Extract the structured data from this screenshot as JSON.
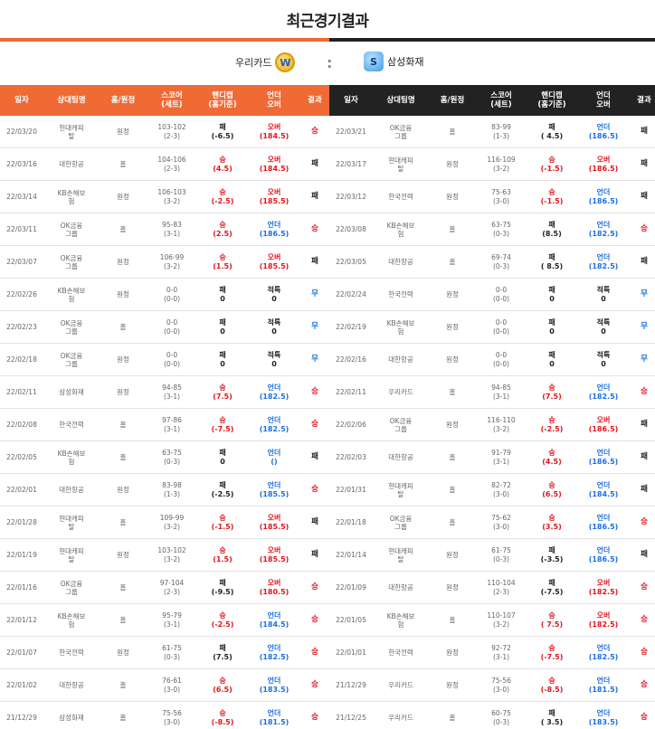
{
  "page": {
    "title": "최근경기결과"
  },
  "teams": {
    "left": "우리카드",
    "vs": ":",
    "right": "삼성화재",
    "left_logo_text": "W",
    "right_logo_text": "S"
  },
  "headers": [
    "일자",
    "상대팀명",
    "홈/원정",
    "스코어\n(세트)",
    "핸디캡\n(홈기준)",
    "언더\n오버",
    "결과"
  ],
  "left_rows": [
    {
      "date": "22/03/20",
      "opp": "현대캐피\n탈",
      "ha": "원정",
      "score": "103-102",
      "sets": "(2-3)",
      "hc_r": "패",
      "hc_v": "(-6.5)",
      "hc_c": "black",
      "ou_r": "오버",
      "ou_v": "(184.5)",
      "ou_c": "red",
      "res": "승",
      "res_c": "red"
    },
    {
      "date": "22/03/16",
      "opp": "대한항공",
      "ha": "홈",
      "score": "104-106",
      "sets": "(2-3)",
      "hc_r": "승",
      "hc_v": "(4.5)",
      "hc_c": "red",
      "ou_r": "오버",
      "ou_v": "(184.5)",
      "ou_c": "red",
      "res": "패",
      "res_c": "black"
    },
    {
      "date": "22/03/14",
      "opp": "KB손해보\n험",
      "ha": "원정",
      "score": "106-103",
      "sets": "(3-2)",
      "hc_r": "승",
      "hc_v": "(-2.5)",
      "hc_c": "red",
      "ou_r": "오버",
      "ou_v": "(185.5)",
      "ou_c": "red",
      "res": "패",
      "res_c": "black"
    },
    {
      "date": "22/03/11",
      "opp": "OK금융\n그룹",
      "ha": "홈",
      "score": "95-83",
      "sets": "(3-1)",
      "hc_r": "승",
      "hc_v": "(2.5)",
      "hc_c": "red",
      "ou_r": "언더",
      "ou_v": "(186.5)",
      "ou_c": "blue",
      "res": "승",
      "res_c": "red"
    },
    {
      "date": "22/03/07",
      "opp": "OK금융\n그룹",
      "ha": "원정",
      "score": "106-99",
      "sets": "(3-2)",
      "hc_r": "승",
      "hc_v": "(1.5)",
      "hc_c": "red",
      "ou_r": "오버",
      "ou_v": "(185.5)",
      "ou_c": "red",
      "res": "패",
      "res_c": "black"
    },
    {
      "date": "22/02/26",
      "opp": "KB손해보\n험",
      "ha": "원정",
      "score": "0-0",
      "sets": "(0-0)",
      "hc_r": "패",
      "hc_v": "0",
      "hc_c": "black",
      "ou_r": "적특",
      "ou_v": "0",
      "ou_c": "black",
      "res": "무",
      "res_c": "blue"
    },
    {
      "date": "22/02/23",
      "opp": "OK금융\n그룹",
      "ha": "홈",
      "score": "0-0",
      "sets": "(0-0)",
      "hc_r": "패",
      "hc_v": "0",
      "hc_c": "black",
      "ou_r": "적특",
      "ou_v": "0",
      "ou_c": "black",
      "res": "무",
      "res_c": "blue"
    },
    {
      "date": "22/02/18",
      "opp": "OK금융\n그룹",
      "ha": "원정",
      "score": "0-0",
      "sets": "(0-0)",
      "hc_r": "패",
      "hc_v": "0",
      "hc_c": "black",
      "ou_r": "적특",
      "ou_v": "0",
      "ou_c": "black",
      "res": "무",
      "res_c": "blue"
    },
    {
      "date": "22/02/11",
      "opp": "삼성화재",
      "ha": "원정",
      "score": "94-85",
      "sets": "(3-1)",
      "hc_r": "승",
      "hc_v": "(7.5)",
      "hc_c": "red",
      "ou_r": "언더",
      "ou_v": "(182.5)",
      "ou_c": "blue",
      "res": "승",
      "res_c": "red"
    },
    {
      "date": "22/02/08",
      "opp": "한국전력",
      "ha": "홈",
      "score": "97-86",
      "sets": "(3-1)",
      "hc_r": "승",
      "hc_v": "(-7.5)",
      "hc_c": "red",
      "ou_r": "언더",
      "ou_v": "(182.5)",
      "ou_c": "blue",
      "res": "승",
      "res_c": "red"
    },
    {
      "date": "22/02/05",
      "opp": "KB손해보\n험",
      "ha": "홈",
      "score": "63-75",
      "sets": "(0-3)",
      "hc_r": "패",
      "hc_v": "0",
      "hc_c": "black",
      "ou_r": "언더",
      "ou_v": "()",
      "ou_c": "blue",
      "res": "패",
      "res_c": "black"
    },
    {
      "date": "22/02/01",
      "opp": "대한항공",
      "ha": "원정",
      "score": "83-98",
      "sets": "(1-3)",
      "hc_r": "패",
      "hc_v": "(-2.5)",
      "hc_c": "black",
      "ou_r": "언더",
      "ou_v": "(185.5)",
      "ou_c": "blue",
      "res": "승",
      "res_c": "red"
    },
    {
      "date": "22/01/28",
      "opp": "현대캐피\n탈",
      "ha": "홈",
      "score": "109-99",
      "sets": "(3-2)",
      "hc_r": "승",
      "hc_v": "(-1.5)",
      "hc_c": "red",
      "ou_r": "오버",
      "ou_v": "(185.5)",
      "ou_c": "red",
      "res": "패",
      "res_c": "black"
    },
    {
      "date": "22/01/19",
      "opp": "현대캐피\n탈",
      "ha": "원정",
      "score": "103-102",
      "sets": "(3-2)",
      "hc_r": "승",
      "hc_v": "(1.5)",
      "hc_c": "red",
      "ou_r": "오버",
      "ou_v": "(185.5)",
      "ou_c": "red",
      "res": "패",
      "res_c": "black"
    },
    {
      "date": "22/01/16",
      "opp": "OK금융\n그룹",
      "ha": "홈",
      "score": "97-104",
      "sets": "(2-3)",
      "hc_r": "패",
      "hc_v": "(-9.5)",
      "hc_c": "black",
      "ou_r": "오버",
      "ou_v": "(180.5)",
      "ou_c": "red",
      "res": "승",
      "res_c": "red"
    },
    {
      "date": "22/01/12",
      "opp": "KB손해보\n험",
      "ha": "홈",
      "score": "95-79",
      "sets": "(3-1)",
      "hc_r": "승",
      "hc_v": "(-2.5)",
      "hc_c": "red",
      "ou_r": "언더",
      "ou_v": "(184.5)",
      "ou_c": "blue",
      "res": "승",
      "res_c": "red"
    },
    {
      "date": "22/01/07",
      "opp": "한국전력",
      "ha": "원정",
      "score": "61-75",
      "sets": "(0-3)",
      "hc_r": "패",
      "hc_v": "(7.5)",
      "hc_c": "black",
      "ou_r": "언더",
      "ou_v": "(182.5)",
      "ou_c": "blue",
      "res": "승",
      "res_c": "red"
    },
    {
      "date": "22/01/02",
      "opp": "대한항공",
      "ha": "홈",
      "score": "76-61",
      "sets": "(3-0)",
      "hc_r": "승",
      "hc_v": "(6.5)",
      "hc_c": "red",
      "ou_r": "언더",
      "ou_v": "(183.5)",
      "ou_c": "blue",
      "res": "승",
      "res_c": "red"
    },
    {
      "date": "21/12/29",
      "opp": "삼성화재",
      "ha": "홈",
      "score": "75-56",
      "sets": "(3-0)",
      "hc_r": "승",
      "hc_v": "(-8.5)",
      "hc_c": "red",
      "ou_r": "언더",
      "ou_v": "(181.5)",
      "ou_c": "blue",
      "res": "승",
      "res_c": "red"
    }
  ],
  "right_rows": [
    {
      "date": "22/03/21",
      "opp": "OK금융\n그룹",
      "ha": "홈",
      "score": "83-99",
      "sets": "(1-3)",
      "hc_r": "패",
      "hc_v": "( 4.5)",
      "hc_c": "black",
      "ou_r": "언더",
      "ou_v": "(186.5)",
      "ou_c": "blue",
      "res": "패",
      "res_c": "black"
    },
    {
      "date": "22/03/17",
      "opp": "현대캐피\n탈",
      "ha": "원정",
      "score": "116-109",
      "sets": "(3-2)",
      "hc_r": "승",
      "hc_v": "(-1.5)",
      "hc_c": "red",
      "ou_r": "오버",
      "ou_v": "(186.5)",
      "ou_c": "red",
      "res": "패",
      "res_c": "black"
    },
    {
      "date": "22/03/12",
      "opp": "한국전력",
      "ha": "원정",
      "score": "75-63",
      "sets": "(3-0)",
      "hc_r": "승",
      "hc_v": "(-1.5)",
      "hc_c": "red",
      "ou_r": "언더",
      "ou_v": "(186.5)",
      "ou_c": "blue",
      "res": "패",
      "res_c": "black"
    },
    {
      "date": "22/03/08",
      "opp": "KB손해보\n험",
      "ha": "홈",
      "score": "63-75",
      "sets": "(0-3)",
      "hc_r": "패",
      "hc_v": "(8.5)",
      "hc_c": "black",
      "ou_r": "언더",
      "ou_v": "(182.5)",
      "ou_c": "blue",
      "res": "승",
      "res_c": "red"
    },
    {
      "date": "22/03/05",
      "opp": "대한항공",
      "ha": "홈",
      "score": "69-74",
      "sets": "(0-3)",
      "hc_r": "패",
      "hc_v": "( 8.5)",
      "hc_c": "black",
      "ou_r": "언더",
      "ou_v": "(182.5)",
      "ou_c": "blue",
      "res": "패",
      "res_c": "black"
    },
    {
      "date": "22/02/24",
      "opp": "한국전력",
      "ha": "원정",
      "score": "0-0",
      "sets": "(0-0)",
      "hc_r": "패",
      "hc_v": "0",
      "hc_c": "black",
      "ou_r": "적특",
      "ou_v": "0",
      "ou_c": "black",
      "res": "무",
      "res_c": "blue"
    },
    {
      "date": "22/02/19",
      "opp": "KB손해보\n험",
      "ha": "원정",
      "score": "0-0",
      "sets": "(0-0)",
      "hc_r": "패",
      "hc_v": "0",
      "hc_c": "black",
      "ou_r": "적특",
      "ou_v": "0",
      "ou_c": "black",
      "res": "무",
      "res_c": "blue"
    },
    {
      "date": "22/02/16",
      "opp": "대한항공",
      "ha": "원정",
      "score": "0-0",
      "sets": "(0-0)",
      "hc_r": "패",
      "hc_v": "0",
      "hc_c": "black",
      "ou_r": "적특",
      "ou_v": "0",
      "ou_c": "black",
      "res": "무",
      "res_c": "blue"
    },
    {
      "date": "22/02/11",
      "opp": "우리카드",
      "ha": "홈",
      "score": "94-85",
      "sets": "(3-1)",
      "hc_r": "승",
      "hc_v": "(7.5)",
      "hc_c": "red",
      "ou_r": "언더",
      "ou_v": "(182.5)",
      "ou_c": "blue",
      "res": "승",
      "res_c": "red"
    },
    {
      "date": "22/02/06",
      "opp": "OK금융\n그룹",
      "ha": "원정",
      "score": "116-110",
      "sets": "(3-2)",
      "hc_r": "승",
      "hc_v": "(-2.5)",
      "hc_c": "red",
      "ou_r": "오버",
      "ou_v": "(186.5)",
      "ou_c": "red",
      "res": "패",
      "res_c": "black"
    },
    {
      "date": "22/02/03",
      "opp": "대한항공",
      "ha": "홈",
      "score": "91-79",
      "sets": "(3-1)",
      "hc_r": "승",
      "hc_v": "(4.5)",
      "hc_c": "red",
      "ou_r": "언더",
      "ou_v": "(186.5)",
      "ou_c": "blue",
      "res": "패",
      "res_c": "black"
    },
    {
      "date": "22/01/31",
      "opp": "현대캐피\n탈",
      "ha": "홈",
      "score": "82-72",
      "sets": "(3-0)",
      "hc_r": "승",
      "hc_v": "(6.5)",
      "hc_c": "red",
      "ou_r": "언더",
      "ou_v": "(184.5)",
      "ou_c": "blue",
      "res": "패",
      "res_c": "black"
    },
    {
      "date": "22/01/18",
      "opp": "OK금융\n그룹",
      "ha": "홈",
      "score": "75-62",
      "sets": "(3-0)",
      "hc_r": "승",
      "hc_v": "(3.5)",
      "hc_c": "red",
      "ou_r": "언더",
      "ou_v": "(186.5)",
      "ou_c": "blue",
      "res": "승",
      "res_c": "red"
    },
    {
      "date": "22/01/14",
      "opp": "현대캐피\n탈",
      "ha": "원정",
      "score": "61-75",
      "sets": "(0-3)",
      "hc_r": "패",
      "hc_v": "(-3.5)",
      "hc_c": "black",
      "ou_r": "언더",
      "ou_v": "(186.5)",
      "ou_c": "blue",
      "res": "패",
      "res_c": "black"
    },
    {
      "date": "22/01/09",
      "opp": "대한항공",
      "ha": "원정",
      "score": "110-104",
      "sets": "(2-3)",
      "hc_r": "패",
      "hc_v": "(-7.5)",
      "hc_c": "black",
      "ou_r": "오버",
      "ou_v": "(182.5)",
      "ou_c": "red",
      "res": "승",
      "res_c": "red"
    },
    {
      "date": "22/01/05",
      "opp": "KB손해보\n험",
      "ha": "홈",
      "score": "110-107",
      "sets": "(3-2)",
      "hc_r": "승",
      "hc_v": "( 7.5)",
      "hc_c": "red",
      "ou_r": "오버",
      "ou_v": "(182.5)",
      "ou_c": "red",
      "res": "승",
      "res_c": "red"
    },
    {
      "date": "22/01/01",
      "opp": "한국전력",
      "ha": "원정",
      "score": "92-72",
      "sets": "(3-1)",
      "hc_r": "승",
      "hc_v": "(-7.5)",
      "hc_c": "red",
      "ou_r": "언더",
      "ou_v": "(182.5)",
      "ou_c": "blue",
      "res": "승",
      "res_c": "red"
    },
    {
      "date": "21/12/29",
      "opp": "우리카드",
      "ha": "원정",
      "score": "75-56",
      "sets": "(3-0)",
      "hc_r": "승",
      "hc_v": "(-8.5)",
      "hc_c": "red",
      "ou_r": "언더",
      "ou_v": "(181.5)",
      "ou_c": "blue",
      "res": "승",
      "res_c": "red"
    },
    {
      "date": "21/12/25",
      "opp": "우리카드",
      "ha": "홈",
      "score": "60-75",
      "sets": "(0-3)",
      "hc_r": "패",
      "hc_v": "( 3.5)",
      "hc_c": "black",
      "ou_r": "언더",
      "ou_v": "(183.5)",
      "ou_c": "blue",
      "res": "승",
      "res_c": "red"
    }
  ]
}
